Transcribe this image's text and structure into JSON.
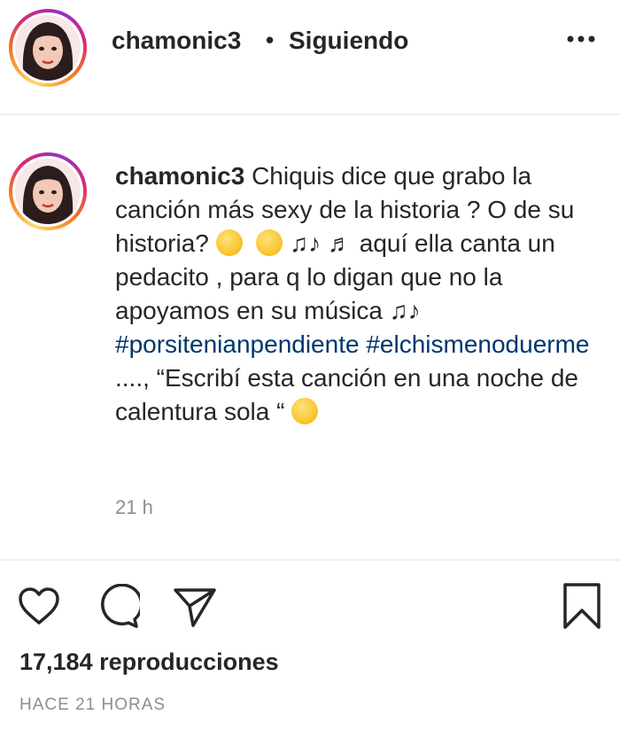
{
  "header": {
    "username": "chamonic3",
    "separator": "•",
    "follow_status": "Siguiendo",
    "more_icon": "more-horizontal-icon"
  },
  "caption": {
    "username": "chamonic3",
    "text_1": "Chiquis dice que grabo la canción más sexy de la historia ? O de su historia?",
    "text_2": "aquí ella canta un pedacito , para q lo digan que no la apoyamos en su música",
    "hashtag_1": "#porsitenianpendiente",
    "hashtag_2": "#elchismenoduerme",
    "text_3": "...., “Escribí esta canción en una noche de calentura sola “",
    "emojis": [
      "thinking-face-emoji",
      "grimacing-face-emoji",
      "musical-notes-emoji",
      "musical-note-emoji",
      "musical-notes-emoji",
      "woozy-face-emoji"
    ],
    "hashtag_color": "#00376b"
  },
  "time_ago": "21 h",
  "stats": {
    "views": "17,184 reproducciones",
    "posted": "HACE 21 HORAS"
  },
  "actions": [
    "heart-icon",
    "comment-icon",
    "share-icon",
    "bookmark-icon"
  ]
}
